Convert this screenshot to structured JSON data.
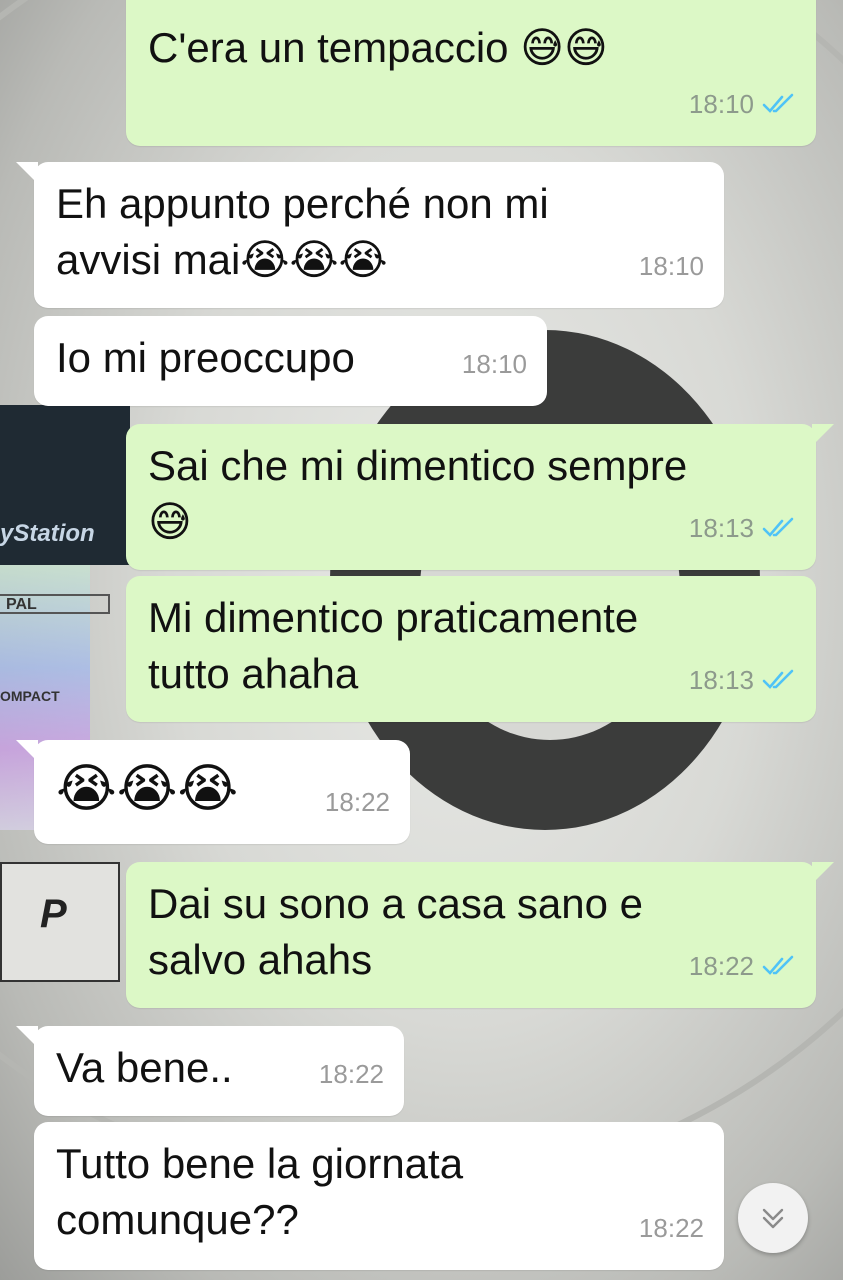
{
  "messages": [
    {
      "text": "C'era un tempaccio 😅😅",
      "time": "18:10"
    },
    {
      "text": "Eh appunto perché non mi\navvisi mai😭😭😭",
      "time": "18:10"
    },
    {
      "text": "Io mi preoccupo",
      "time": "18:10"
    },
    {
      "text": "Sai che mi dimentico sempre\n😅",
      "time": "18:13"
    },
    {
      "text": "Mi dimentico praticamente\ntutto ahaha",
      "time": "18:13"
    },
    {
      "text": "😭😭😭",
      "time": "18:22"
    },
    {
      "text": "Dai su sono a casa sano e\nsalvo ahahs",
      "time": "18:22"
    },
    {
      "text": "Va bene..",
      "time": "18:22"
    },
    {
      "text": "Tutto bene la giornata\ncomunque??",
      "time": "18:22"
    }
  ],
  "wallpaper": {
    "label_brand": "yStation",
    "label_pal": "PAL",
    "label_compact": "OMPACT",
    "label_p": "P"
  },
  "icons": {
    "read_receipt": "double-check-icon",
    "scroll": "chevron-double-down-icon"
  },
  "colors": {
    "outgoing_bubble": "#dcf8c6",
    "incoming_bubble": "#ffffff",
    "read_ticks": "#4fc3f7"
  }
}
